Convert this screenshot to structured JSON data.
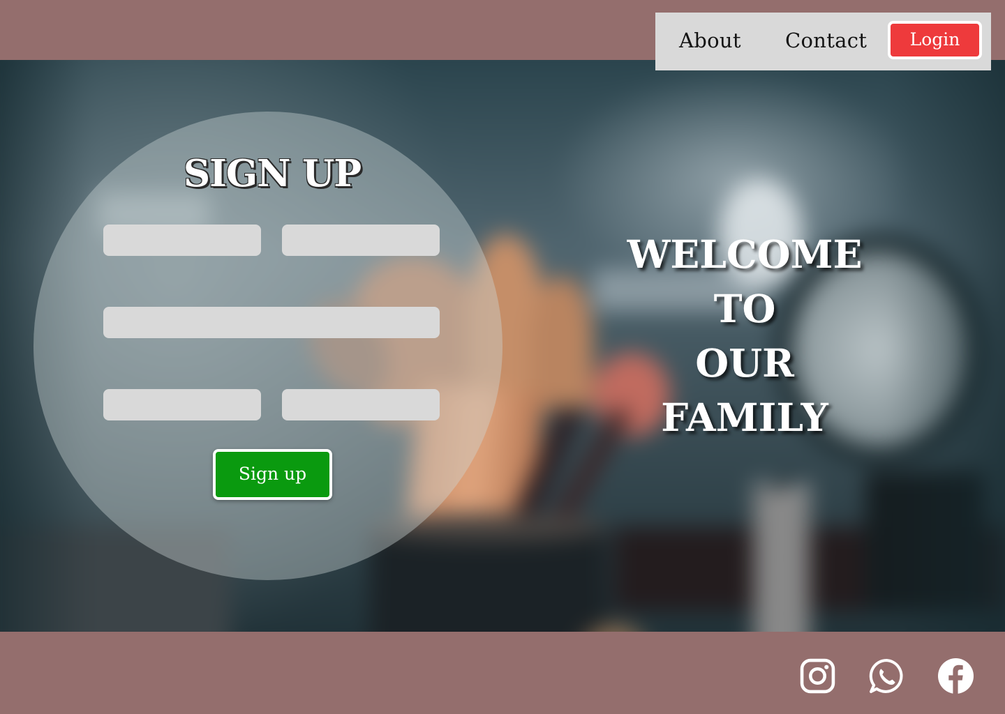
{
  "nav": {
    "about_label": "About",
    "contact_label": "Contact",
    "login_label": "Login"
  },
  "signup": {
    "title": "SIGN UP",
    "button_label": "Sign up",
    "first_name": {
      "value": "",
      "placeholder": ""
    },
    "last_name": {
      "value": "",
      "placeholder": ""
    },
    "email": {
      "value": "",
      "placeholder": ""
    },
    "password": {
      "value": "",
      "placeholder": ""
    },
    "confirm_password": {
      "value": "",
      "placeholder": ""
    }
  },
  "hero": {
    "welcome_lines": [
      "WELCOME",
      "TO",
      "OUR",
      "FAMILY"
    ]
  },
  "footer": {
    "icons": [
      "instagram-icon",
      "whatsapp-icon",
      "facebook-icon"
    ]
  },
  "colors": {
    "page_background": "#946e6d",
    "nav_background": "#d9d9d9",
    "login_button": "#ee3a3c",
    "signup_button": "#0a9a0f",
    "input_background": "#d9d9d9"
  }
}
